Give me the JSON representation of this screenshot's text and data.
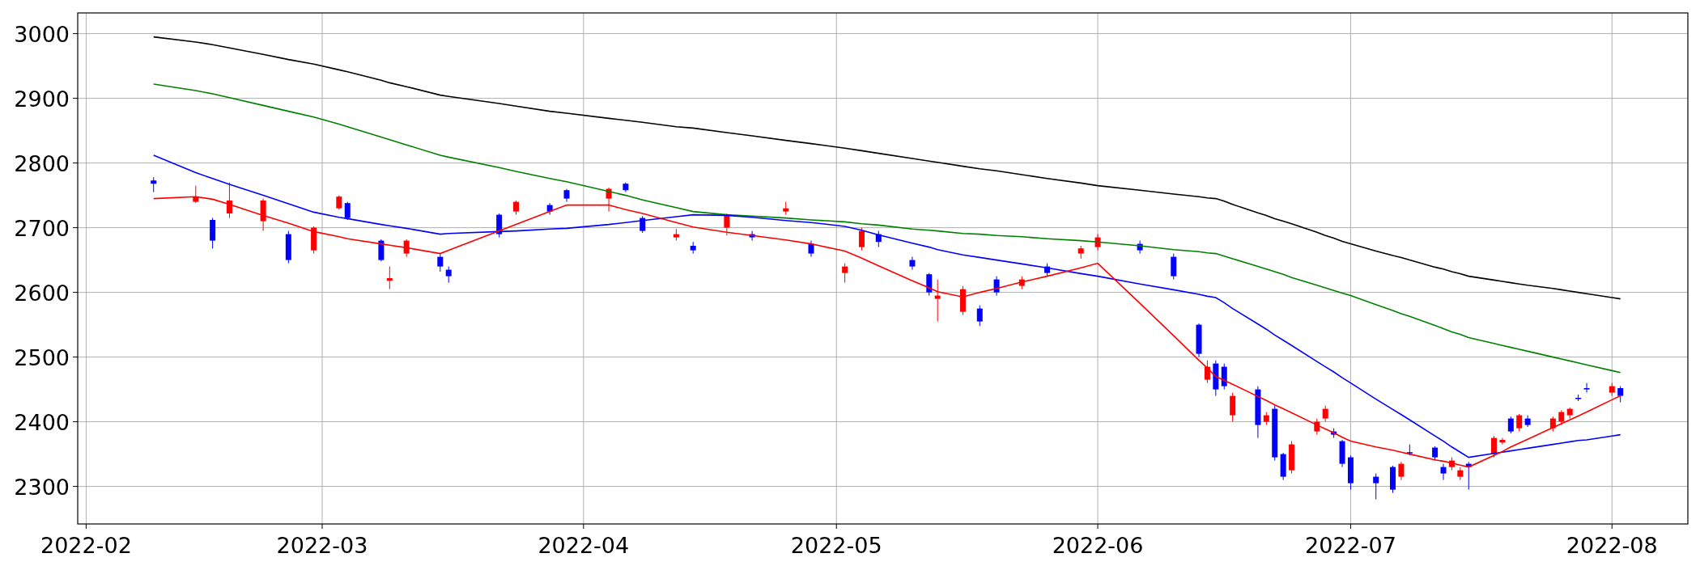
{
  "chart": {
    "chart_data": {
      "type": "candlestick",
      "grid": true,
      "xlim": [
        "2022-01-31",
        "2022-08-10"
      ],
      "ylim": [
        2242,
        3032
      ],
      "xticks": [
        {
          "value": "2022-02-01",
          "label": "2022-02"
        },
        {
          "value": "2022-03-01",
          "label": "2022-03"
        },
        {
          "value": "2022-04-01",
          "label": "2022-04"
        },
        {
          "value": "2022-05-01",
          "label": "2022-05"
        },
        {
          "value": "2022-06-01",
          "label": "2022-06"
        },
        {
          "value": "2022-07-01",
          "label": "2022-07"
        },
        {
          "value": "2022-08-01",
          "label": "2022-08"
        }
      ],
      "yticks": [
        2300,
        2400,
        2500,
        2600,
        2700,
        2800,
        2900,
        3000
      ],
      "x": [
        "2022-02-09",
        "2022-02-14",
        "2022-02-16",
        "2022-02-18",
        "2022-02-22",
        "2022-02-25",
        "2022-02-28",
        "2022-03-03",
        "2022-03-04",
        "2022-03-08",
        "2022-03-09",
        "2022-03-11",
        "2022-03-15",
        "2022-03-16",
        "2022-03-22",
        "2022-03-24",
        "2022-03-28",
        "2022-03-30",
        "2022-04-04",
        "2022-04-06",
        "2022-04-08",
        "2022-04-12",
        "2022-04-14",
        "2022-04-18",
        "2022-04-21",
        "2022-04-25",
        "2022-04-28",
        "2022-05-02",
        "2022-05-04",
        "2022-05-06",
        "2022-05-10",
        "2022-05-12",
        "2022-05-13",
        "2022-05-16",
        "2022-05-18",
        "2022-05-20",
        "2022-05-23",
        "2022-05-26",
        "2022-05-30",
        "2022-06-01",
        "2022-06-06",
        "2022-06-10",
        "2022-06-13",
        "2022-06-14",
        "2022-06-15",
        "2022-06-16",
        "2022-06-17",
        "2022-06-20",
        "2022-06-21",
        "2022-06-22",
        "2022-06-23",
        "2022-06-24",
        "2022-06-27",
        "2022-06-28",
        "2022-06-29",
        "2022-06-30",
        "2022-07-01",
        "2022-07-04",
        "2022-07-06",
        "2022-07-07",
        "2022-07-08",
        "2022-07-11",
        "2022-07-12",
        "2022-07-13",
        "2022-07-14",
        "2022-07-15",
        "2022-07-18",
        "2022-07-19",
        "2022-07-20",
        "2022-07-21",
        "2022-07-22",
        "2022-07-25",
        "2022-07-26",
        "2022-07-27",
        "2022-07-28",
        "2022-07-29",
        "2022-08-01",
        "2022-08-02"
      ],
      "ohlc": [
        [
          2773,
          2778,
          2755,
          2768
        ],
        [
          2740,
          2765,
          2738,
          2748
        ],
        [
          2712,
          2715,
          2668,
          2680
        ],
        [
          2722,
          2770,
          2715,
          2742
        ],
        [
          2710,
          2745,
          2695,
          2742
        ],
        [
          2690,
          2695,
          2645,
          2650
        ],
        [
          2665,
          2702,
          2660,
          2700
        ],
        [
          2730,
          2750,
          2728,
          2748
        ],
        [
          2738,
          2740,
          2712,
          2715
        ],
        [
          2680,
          2682,
          2648,
          2650
        ],
        [
          2618,
          2640,
          2605,
          2622
        ],
        [
          2660,
          2682,
          2655,
          2680
        ],
        [
          2655,
          2660,
          2632,
          2640
        ],
        [
          2635,
          2640,
          2615,
          2625
        ],
        [
          2720,
          2722,
          2685,
          2690
        ],
        [
          2725,
          2742,
          2720,
          2740
        ],
        [
          2735,
          2738,
          2720,
          2725
        ],
        [
          2758,
          2760,
          2740,
          2745
        ],
        [
          2745,
          2762,
          2725,
          2760
        ],
        [
          2768,
          2770,
          2755,
          2758
        ],
        [
          2715,
          2718,
          2692,
          2695
        ],
        [
          2685,
          2698,
          2680,
          2690
        ],
        [
          2672,
          2678,
          2660,
          2665
        ],
        [
          2700,
          2722,
          2688,
          2720
        ],
        [
          2690,
          2695,
          2680,
          2685
        ],
        [
          2725,
          2740,
          2720,
          2730
        ],
        [
          2675,
          2680,
          2655,
          2660
        ],
        [
          2630,
          2645,
          2615,
          2640
        ],
        [
          2670,
          2700,
          2665,
          2695
        ],
        [
          2690,
          2695,
          2670,
          2678
        ],
        [
          2650,
          2655,
          2635,
          2640
        ],
        [
          2628,
          2630,
          2595,
          2600
        ],
        [
          2590,
          2620,
          2555,
          2595
        ],
        [
          2570,
          2610,
          2565,
          2605
        ],
        [
          2575,
          2580,
          2548,
          2555
        ],
        [
          2620,
          2625,
          2595,
          2600
        ],
        [
          2610,
          2625,
          2605,
          2620
        ],
        [
          2640,
          2645,
          2625,
          2630
        ],
        [
          2660,
          2672,
          2652,
          2668
        ],
        [
          2670,
          2690,
          2665,
          2685
        ],
        [
          2675,
          2680,
          2660,
          2665
        ],
        [
          2655,
          2660,
          2620,
          2625
        ],
        [
          2550,
          2552,
          2500,
          2505
        ],
        [
          2465,
          2495,
          2460,
          2485
        ],
        [
          2490,
          2495,
          2440,
          2450
        ],
        [
          2485,
          2490,
          2450,
          2455
        ],
        [
          2410,
          2445,
          2400,
          2440
        ],
        [
          2450,
          2455,
          2375,
          2395
        ],
        [
          2400,
          2415,
          2395,
          2410
        ],
        [
          2420,
          2425,
          2340,
          2345
        ],
        [
          2350,
          2352,
          2310,
          2315
        ],
        [
          2325,
          2370,
          2320,
          2365
        ],
        [
          2385,
          2405,
          2380,
          2400
        ],
        [
          2405,
          2425,
          2400,
          2420
        ],
        [
          2385,
          2390,
          2375,
          2380
        ],
        [
          2370,
          2372,
          2330,
          2335
        ],
        [
          2345,
          2348,
          2295,
          2305
        ],
        [
          2315,
          2320,
          2280,
          2305
        ],
        [
          2330,
          2332,
          2290,
          2295
        ],
        [
          2315,
          2338,
          2310,
          2335
        ],
        [
          2353,
          2365,
          2348,
          2351
        ],
        [
          2360,
          2362,
          2340,
          2345
        ],
        [
          2330,
          2335,
          2310,
          2320
        ],
        [
          2330,
          2345,
          2325,
          2340
        ],
        [
          2315,
          2330,
          2310,
          2325
        ],
        [
          2335,
          2338,
          2295,
          2330
        ],
        [
          2350,
          2378,
          2345,
          2375
        ],
        [
          2368,
          2375,
          2365,
          2372
        ],
        [
          2405,
          2408,
          2382,
          2385
        ],
        [
          2390,
          2412,
          2385,
          2410
        ],
        [
          2405,
          2410,
          2392,
          2395
        ],
        [
          2390,
          2408,
          2385,
          2405
        ],
        [
          2400,
          2418,
          2395,
          2415
        ],
        [
          2410,
          2422,
          2405,
          2420
        ],
        [
          2437,
          2442,
          2432,
          2435
        ],
        [
          2452,
          2460,
          2445,
          2450
        ],
        [
          2445,
          2460,
          2440,
          2455
        ],
        [
          2452,
          2455,
          2430,
          2440
        ]
      ]
    }
  },
  "moving_averages": {
    "chart_data": {
      "type": "line",
      "xlim": [
        "2022-01-31",
        "2022-08-10"
      ],
      "ylim": [
        2242,
        3032
      ],
      "x": [
        "2022-02-09",
        "2022-02-14",
        "2022-02-16",
        "2022-02-18",
        "2022-02-22",
        "2022-02-25",
        "2022-02-28",
        "2022-03-03",
        "2022-03-04",
        "2022-03-08",
        "2022-03-09",
        "2022-03-11",
        "2022-03-15",
        "2022-03-16",
        "2022-03-22",
        "2022-03-24",
        "2022-03-28",
        "2022-03-30",
        "2022-04-04",
        "2022-04-06",
        "2022-04-08",
        "2022-04-12",
        "2022-04-14",
        "2022-04-18",
        "2022-04-21",
        "2022-04-25",
        "2022-04-28",
        "2022-05-02",
        "2022-05-04",
        "2022-05-06",
        "2022-05-10",
        "2022-05-12",
        "2022-05-13",
        "2022-05-16",
        "2022-05-18",
        "2022-05-20",
        "2022-05-23",
        "2022-05-26",
        "2022-05-30",
        "2022-06-01",
        "2022-06-06",
        "2022-06-10",
        "2022-06-13",
        "2022-06-14",
        "2022-06-15",
        "2022-06-16",
        "2022-06-17",
        "2022-06-20",
        "2022-06-21",
        "2022-06-22",
        "2022-06-23",
        "2022-06-24",
        "2022-06-27",
        "2022-06-28",
        "2022-06-29",
        "2022-06-30",
        "2022-07-01",
        "2022-07-04",
        "2022-07-06",
        "2022-07-07",
        "2022-07-08",
        "2022-07-11",
        "2022-07-12",
        "2022-07-13",
        "2022-07-14",
        "2022-07-15",
        "2022-07-18",
        "2022-07-19",
        "2022-07-20",
        "2022-07-21",
        "2022-07-22",
        "2022-07-25",
        "2022-07-26",
        "2022-07-27",
        "2022-07-28",
        "2022-07-29",
        "2022-08-01",
        "2022-08-02"
      ],
      "series": [
        {
          "color": "#000000",
          "values": [
            2995,
            2987,
            2983,
            2978,
            2968,
            2960,
            2953,
            2944,
            2941,
            2928,
            2924,
            2918,
            2905,
            2903,
            2892,
            2888,
            2880,
            2877,
            2869,
            2866,
            2863,
            2856,
            2854,
            2847,
            2842,
            2835,
            2830,
            2823,
            2819,
            2815,
            2807,
            2803,
            2801,
            2795,
            2791,
            2788,
            2782,
            2776,
            2769,
            2765,
            2758,
            2752,
            2748,
            2746,
            2745,
            2741,
            2736,
            2723,
            2719,
            2714,
            2710,
            2706,
            2693,
            2688,
            2684,
            2679,
            2675,
            2664,
            2657,
            2654,
            2650,
            2639,
            2636,
            2632,
            2629,
            2625,
            2619,
            2617,
            2615,
            2613,
            2611,
            2606,
            2604,
            2602,
            2600,
            2598,
            2592,
            2590
          ]
        },
        {
          "color": "#008000",
          "values": [
            2922,
            2912,
            2907,
            2901,
            2889,
            2880,
            2871,
            2860,
            2856,
            2840,
            2836,
            2828,
            2812,
            2809,
            2793,
            2787,
            2776,
            2771,
            2756,
            2750,
            2743,
            2731,
            2725,
            2720,
            2718,
            2715,
            2712,
            2709,
            2706,
            2704,
            2698,
            2696,
            2695,
            2691,
            2690,
            2688,
            2686,
            2683,
            2680,
            2678,
            2672,
            2666,
            2663,
            2661,
            2660,
            2656,
            2652,
            2640,
            2636,
            2632,
            2628,
            2623,
            2611,
            2607,
            2603,
            2599,
            2595,
            2581,
            2572,
            2567,
            2563,
            2549,
            2544,
            2539,
            2535,
            2530,
            2521,
            2518,
            2515,
            2512,
            2509,
            2500,
            2497,
            2494,
            2491,
            2488,
            2479,
            2476
          ]
        },
        {
          "color": "#0000ff",
          "values": [
            2812,
            2785,
            2776,
            2767,
            2750,
            2737,
            2724,
            2716,
            2714,
            2705,
            2703,
            2699,
            2690,
            2691,
            2694,
            2695,
            2698,
            2699,
            2705,
            2708,
            2711,
            2717,
            2720,
            2719,
            2716,
            2711,
            2708,
            2702,
            2696,
            2689,
            2676,
            2670,
            2666,
            2658,
            2654,
            2650,
            2644,
            2638,
            2629,
            2625,
            2613,
            2604,
            2597,
            2594,
            2592,
            2584,
            2575,
            2551,
            2543,
            2534,
            2526,
            2518,
            2493,
            2485,
            2477,
            2468,
            2460,
            2435,
            2419,
            2411,
            2403,
            2378,
            2370,
            2361,
            2353,
            2345,
            2351,
            2353,
            2355,
            2357,
            2359,
            2365,
            2367,
            2369,
            2371,
            2372,
            2378,
            2380
          ]
        },
        {
          "color": "#ff0000",
          "values": [
            2745,
            2748,
            2744,
            2736,
            2719,
            2707,
            2694,
            2686,
            2683,
            2675,
            2673,
            2669,
            2660,
            2665,
            2695,
            2705,
            2725,
            2735,
            2735,
            2728,
            2722,
            2708,
            2701,
            2693,
            2688,
            2681,
            2675,
            2664,
            2653,
            2641,
            2618,
            2607,
            2601,
            2593,
            2600,
            2606,
            2616,
            2625,
            2638,
            2645,
            2583,
            2533,
            2495,
            2483,
            2470,
            2464,
            2458,
            2439,
            2433,
            2426,
            2420,
            2414,
            2395,
            2389,
            2383,
            2376,
            2370,
            2361,
            2356,
            2353,
            2350,
            2341,
            2339,
            2336,
            2333,
            2330,
            2348,
            2354,
            2361,
            2367,
            2373,
            2391,
            2397,
            2403,
            2409,
            2415,
            2434,
            2440
          ]
        }
      ]
    }
  }
}
